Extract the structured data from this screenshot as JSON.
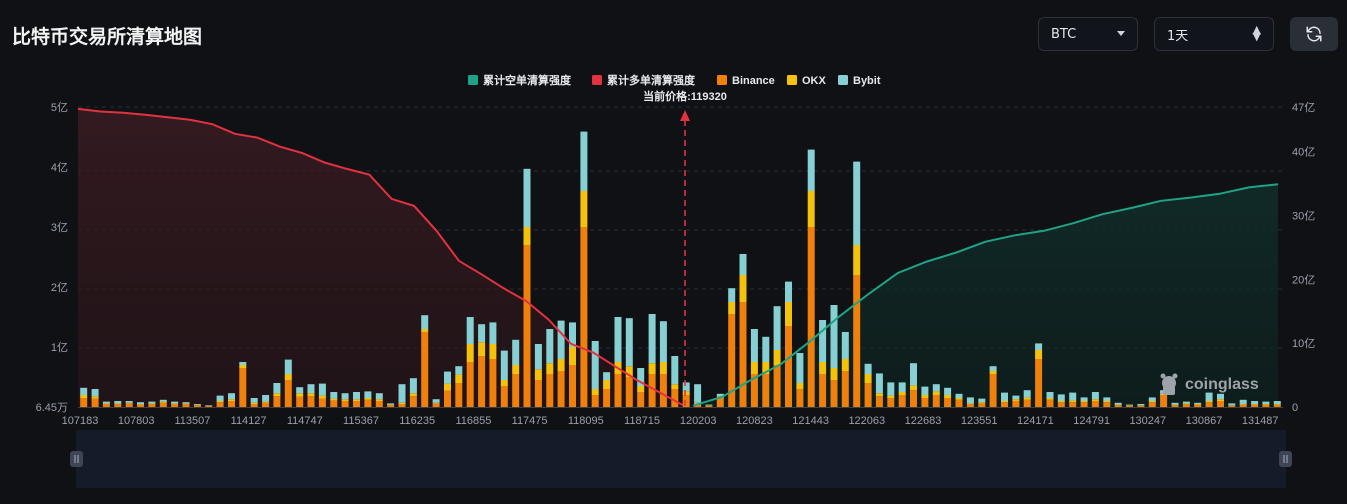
{
  "header": {
    "title": "比特币交易所清算地图",
    "symbol_select": "BTC",
    "period_select": "1天",
    "refresh_icon": "refresh-icon"
  },
  "colors": {
    "background": "#0f1115",
    "short_cumulative": "#1fa386",
    "long_cumulative": "#e2323f",
    "binance": "#f0800c",
    "okx": "#f5c20b",
    "bybit": "#86d0d3"
  },
  "chart_data": {
    "type": "bar",
    "current_price_label": "当前价格:119320",
    "current_price": 119320,
    "legend": [
      "累计空单清算强度",
      "累计多单清算强度",
      "Binance",
      "OKX",
      "Bybit"
    ],
    "y_left_ticks": [
      "6.45万",
      "1亿",
      "2亿",
      "3亿",
      "4亿",
      "5亿"
    ],
    "y_right_ticks": [
      "0",
      "10亿",
      "20亿",
      "30亿",
      "40亿",
      "47亿"
    ],
    "x_tick_labels": [
      "107183",
      "107803",
      "113507",
      "114127",
      "114747",
      "115367",
      "116235",
      "116855",
      "117475",
      "118095",
      "118715",
      "120203",
      "120823",
      "121443",
      "122063",
      "122683",
      "123551",
      "124171",
      "124791",
      "130247",
      "130867",
      "131487"
    ],
    "watermark": "coinglass",
    "stacked_bars": [
      [
        0.15,
        0.05,
        0.12
      ],
      [
        0.14,
        0.04,
        0.12
      ],
      [
        0.05,
        0.01,
        0.03
      ],
      [
        0.05,
        0.01,
        0.04
      ],
      [
        0.06,
        0.01,
        0.03
      ],
      [
        0.04,
        0.01,
        0.03
      ],
      [
        0.05,
        0.01,
        0.03
      ],
      [
        0.07,
        0.02,
        0.03
      ],
      [
        0.05,
        0.01,
        0.03
      ],
      [
        0.05,
        0.01,
        0.02
      ],
      [
        0.03,
        0.01,
        0.01
      ],
      [
        0.02,
        0,
        0.01
      ],
      [
        0.08,
        0.02,
        0.09
      ],
      [
        0.1,
        0.03,
        0.1
      ],
      [
        0.65,
        0.05,
        0.05
      ],
      [
        0.05,
        0.02,
        0.08
      ],
      [
        0.07,
        0.02,
        0.11
      ],
      [
        0.18,
        0.05,
        0.17
      ],
      [
        0.45,
        0.1,
        0.24
      ],
      [
        0.17,
        0.06,
        0.1
      ],
      [
        0.18,
        0.05,
        0.15
      ],
      [
        0.14,
        0.05,
        0.2
      ],
      [
        0.11,
        0.03,
        0.11
      ],
      [
        0.1,
        0.03,
        0.1
      ],
      [
        0.1,
        0.03,
        0.12
      ],
      [
        0.12,
        0.03,
        0.11
      ],
      [
        0.1,
        0.03,
        0.1
      ],
      [
        0.03,
        0.01,
        0.02
      ],
      [
        0.05,
        0.02,
        0.31
      ],
      [
        0.18,
        0.05,
        0.25
      ],
      [
        1.25,
        0.05,
        0.23
      ],
      [
        0.06,
        0.01,
        0.06
      ],
      [
        0.27,
        0.12,
        0.2
      ],
      [
        0.4,
        0.14,
        0.14
      ],
      [
        0.75,
        0.3,
        0.45
      ],
      [
        0.85,
        0.23,
        0.3
      ],
      [
        0.8,
        0.25,
        0.36
      ],
      [
        0.35,
        0.1,
        0.49
      ],
      [
        0.55,
        0.15,
        0.42
      ],
      [
        2.7,
        0.3,
        0.97
      ],
      [
        0.45,
        0.18,
        0.42
      ],
      [
        0.55,
        0.18,
        0.57
      ],
      [
        0.6,
        0.2,
        0.64
      ],
      [
        0.7,
        0.3,
        0.41
      ],
      [
        3.0,
        0.6,
        0.99
      ],
      [
        0.2,
        0.1,
        0.8
      ],
      [
        0.3,
        0.15,
        0.13
      ],
      [
        0.55,
        0.2,
        0.75
      ],
      [
        0.5,
        0.18,
        0.8
      ],
      [
        0.25,
        0.1,
        0.3
      ],
      [
        0.55,
        0.18,
        0.82
      ],
      [
        0.55,
        0.2,
        0.68
      ],
      [
        0.3,
        0.08,
        0.47
      ],
      [
        0.2,
        0.06,
        0.15
      ],
      [
        0.05,
        0.02,
        0.31
      ],
      [
        0.02,
        0.01,
        0.01
      ],
      [
        0.15,
        0.03,
        0.04
      ],
      [
        1.55,
        0.2,
        0.23
      ],
      [
        1.75,
        0.45,
        0.35
      ],
      [
        0.55,
        0.2,
        0.55
      ],
      [
        0.55,
        0.2,
        0.42
      ],
      [
        0.7,
        0.25,
        0.73
      ],
      [
        1.35,
        0.4,
        0.34
      ],
      [
        0.3,
        0.1,
        0.5
      ],
      [
        3.0,
        0.6,
        0.69
      ],
      [
        0.55,
        0.2,
        0.7
      ],
      [
        0.45,
        0.2,
        1.05
      ],
      [
        0.6,
        0.2,
        0.45
      ],
      [
        2.2,
        0.5,
        1.39
      ],
      [
        0.4,
        0.15,
        0.17
      ],
      [
        0.18,
        0.05,
        0.33
      ],
      [
        0.15,
        0.04,
        0.22
      ],
      [
        0.2,
        0.05,
        0.16
      ],
      [
        0.28,
        0.08,
        0.37
      ],
      [
        0.15,
        0.05,
        0.14
      ],
      [
        0.2,
        0.06,
        0.12
      ],
      [
        0.15,
        0.05,
        0.12
      ],
      [
        0.12,
        0.03,
        0.07
      ],
      [
        0.05,
        0.01,
        0.1
      ],
      [
        0.06,
        0.02,
        0.06
      ],
      [
        0.55,
        0.05,
        0.08
      ],
      [
        0.08,
        0.02,
        0.14
      ],
      [
        0.1,
        0.03,
        0.06
      ],
      [
        0.12,
        0.04,
        0.12
      ],
      [
        0.8,
        0.15,
        0.11
      ],
      [
        0.12,
        0.03,
        0.1
      ],
      [
        0.08,
        0.02,
        0.11
      ],
      [
        0.08,
        0.03,
        0.13
      ],
      [
        0.08,
        0.02,
        0.06
      ],
      [
        0.1,
        0.03,
        0.12
      ],
      [
        0.08,
        0.02,
        0.06
      ],
      [
        0.03,
        0.01,
        0.03
      ],
      [
        0.02,
        0.01,
        0.01
      ],
      [
        0.02,
        0.01,
        0.02
      ],
      [
        0.08,
        0.02,
        0.06
      ],
      [
        0.2,
        0.02,
        0.06
      ],
      [
        0.03,
        0.01,
        0.03
      ],
      [
        0.05,
        0.01,
        0.03
      ],
      [
        0.04,
        0.01,
        0.02
      ],
      [
        0.08,
        0.02,
        0.14
      ],
      [
        0.1,
        0.03,
        0.09
      ],
      [
        0.02,
        0.01,
        0.03
      ],
      [
        0.04,
        0.01,
        0.07
      ],
      [
        0.04,
        0.01,
        0.05
      ],
      [
        0.04,
        0.01,
        0.04
      ],
      [
        0.04,
        0.01,
        0.05
      ]
    ],
    "long_cumulative_yi": [
      46.7,
      46.3,
      46.1,
      45.8,
      45.4,
      45.0,
      44.3,
      42.8,
      42.2,
      40.8,
      39.8,
      38.3,
      37.3,
      36.4,
      32.6,
      31.5,
      27.6,
      22.9,
      20.8,
      18.6,
      16.6,
      13.7,
      9.9,
      8.5,
      6.3,
      4.1,
      2.2,
      0.3
    ],
    "short_cumulative_yi": [
      0.2,
      1.6,
      4.3,
      6.7,
      10.3,
      14.2,
      17.7,
      21.0,
      22.8,
      24.2,
      25.9,
      26.9,
      27.6,
      28.8,
      30.2,
      31.2,
      32.3,
      32.8,
      33.4,
      34.4,
      34.9
    ]
  }
}
